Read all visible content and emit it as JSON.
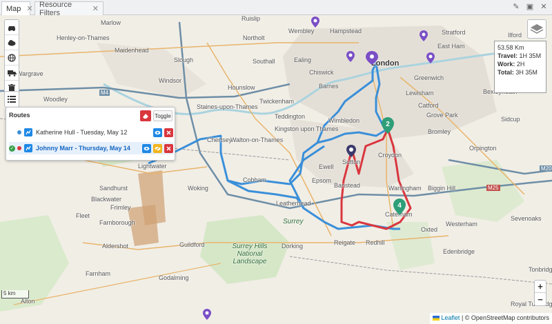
{
  "tabs": [
    {
      "label": "Map"
    },
    {
      "label": "Resource Filters"
    }
  ],
  "toolbar": {
    "buttons": [
      "car-icon",
      "cloud-icon",
      "globe-icon",
      "truck-icon",
      "trash-icon"
    ],
    "list_button": "list-icon"
  },
  "routes_panel": {
    "title": "Routes",
    "toggle_label": "Toggle",
    "items": [
      {
        "label": "Katherine Hull - Tuesday, May 12",
        "color": "#3a8fd9",
        "active": false
      },
      {
        "label": "Johnny Marr - Thursday, May 14",
        "color": "#d9363e",
        "active": true
      }
    ]
  },
  "summary": {
    "distance": "53.58 Km",
    "travel_label": "Travel:",
    "travel_value": "1H 35M",
    "work_label": "Work:",
    "work_value": "2H",
    "total_label": "Total:",
    "total_value": "3H 35M"
  },
  "map": {
    "places": [
      "Marlow",
      "Henley-on-Thames",
      "Maidenhead",
      "Slough",
      "Windsor",
      "Wargrave",
      "Woodley",
      "Sandhurst",
      "Blackwater",
      "Frimley",
      "Farnborough",
      "Aldershot",
      "Farnham",
      "Fleet",
      "Alton",
      "Lightwater",
      "Chertsey",
      "Woking",
      "Guildford",
      "Godalming",
      "Walton-on-Thames",
      "Staines-upon-Thames",
      "Hounslow",
      "Twickenham",
      "Teddington",
      "Kingston upon Thames",
      "Wimbledon",
      "Ewell",
      "Epsom",
      "Cobham",
      "Leatherhead",
      "Dorking",
      "Reigate",
      "Redhill",
      "Banstead",
      "Sutton",
      "Croydon",
      "Warlingham",
      "Caterham",
      "Oxted",
      "Westerham",
      "Sevenoaks",
      "Edenbridge",
      "Tonbridge",
      "Biggin Hill",
      "Orpington",
      "Bromley",
      "Bexleyheath",
      "Lewisham",
      "Greenwich",
      "East Ham",
      "London",
      "Hampstead",
      "Wembley",
      "Northolt",
      "Southall",
      "Ealing",
      "Chiswick",
      "Barnes",
      "Catford",
      "Grove Park",
      "Sidcup",
      "Surrey",
      "Surrey Hills National Landscape",
      "Ruislip",
      "Stratford",
      "Ilford",
      "Royal Tunbridge Wells"
    ],
    "roads": [
      "M4",
      "M25",
      "M20"
    ],
    "stop_markers": [
      "2",
      "4"
    ],
    "scale_label": "5 km"
  },
  "attribution": {
    "leaflet": "Leaflet",
    "separator": "|",
    "copyright": "© OpenStreetMap contributors"
  }
}
